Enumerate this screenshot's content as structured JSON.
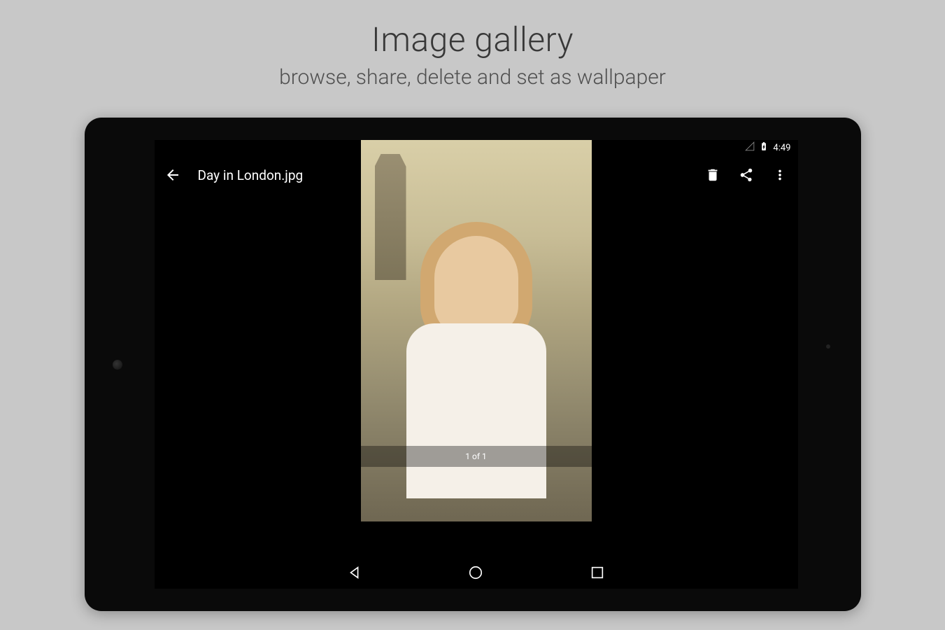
{
  "header": {
    "title": "Image gallery",
    "subtitle": "browse, share, delete and set as wallpaper"
  },
  "status_bar": {
    "time": "4:49"
  },
  "app_bar": {
    "title": "Day in London.jpg"
  },
  "viewer": {
    "counter": "1 of 1"
  }
}
